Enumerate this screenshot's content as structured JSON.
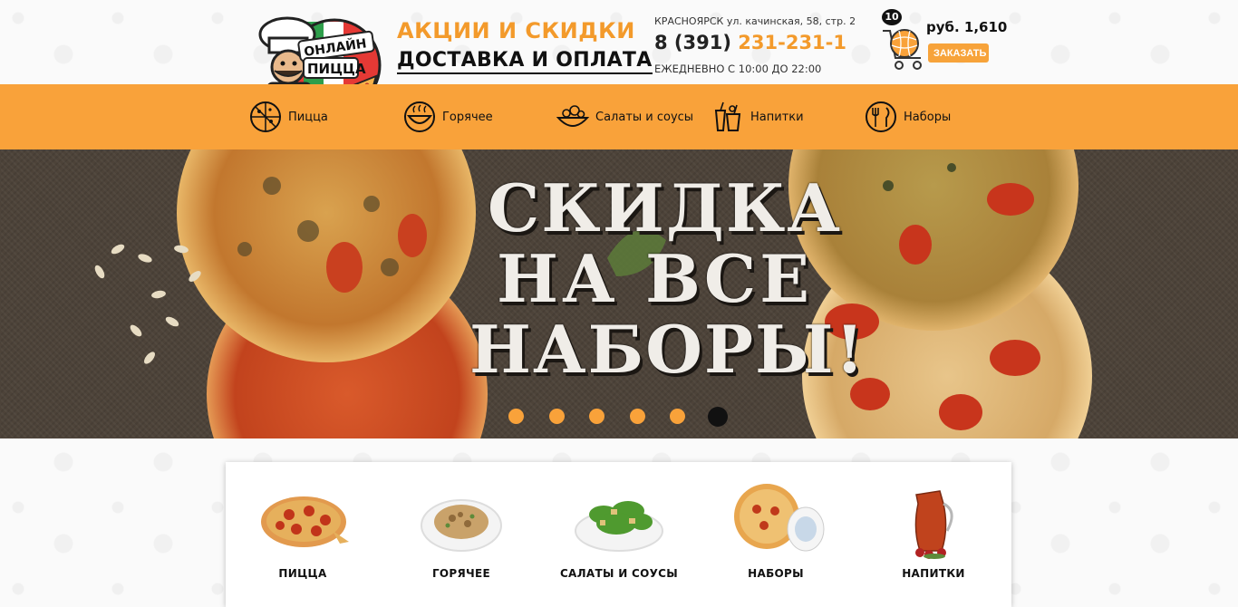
{
  "header": {
    "logo_text_1": "ОНЛАЙН",
    "logo_text_2": "ПИЦЦА",
    "promo_link": "АКЦИИ И СКИДКИ",
    "delivery_link": "ДОСТАВКА И ОПЛАТА",
    "address": "КРАСНОЯРСК ул. качинская, 58, стр. 2",
    "phone_prefix": "8 (391)",
    "phone_number": "231-231-1",
    "hours": "ЕЖЕДНЕВНО С 10:00 ДО 22:00",
    "cart_count": "10",
    "cart_total": "руб. 1,610",
    "order_button": "ЗАКАЗАТЬ"
  },
  "nav": {
    "items": [
      {
        "label": "Пицца",
        "icon": "pizza-icon"
      },
      {
        "label": "Горячее",
        "icon": "hot-dish-icon"
      },
      {
        "label": "Салаты и соусы",
        "icon": "salad-icon"
      },
      {
        "label": "Напитки",
        "icon": "drinks-icon"
      },
      {
        "label": "Наборы",
        "icon": "cutlery-icon"
      }
    ]
  },
  "banner": {
    "line1": "СКИДКА",
    "line2a": "НА",
    "line2b": "ВСЕ",
    "line3": "НАБОРЫ!",
    "slides_total": 6,
    "active_slide": 6
  },
  "categories": [
    {
      "label": "ПИЦЦА",
      "icon": "pizza-image"
    },
    {
      "label": "ГОРЯЧЕЕ",
      "icon": "hot-dish-image"
    },
    {
      "label": "САЛАТЫ И СОУСЫ",
      "icon": "salad-image"
    },
    {
      "label": "НАБОРЫ",
      "icon": "set-image"
    },
    {
      "label": "НАПИТКИ",
      "icon": "drink-image"
    }
  ],
  "colors": {
    "accent": "#f9a23a",
    "banner_bg": "#4d4339",
    "text": "#111111"
  }
}
